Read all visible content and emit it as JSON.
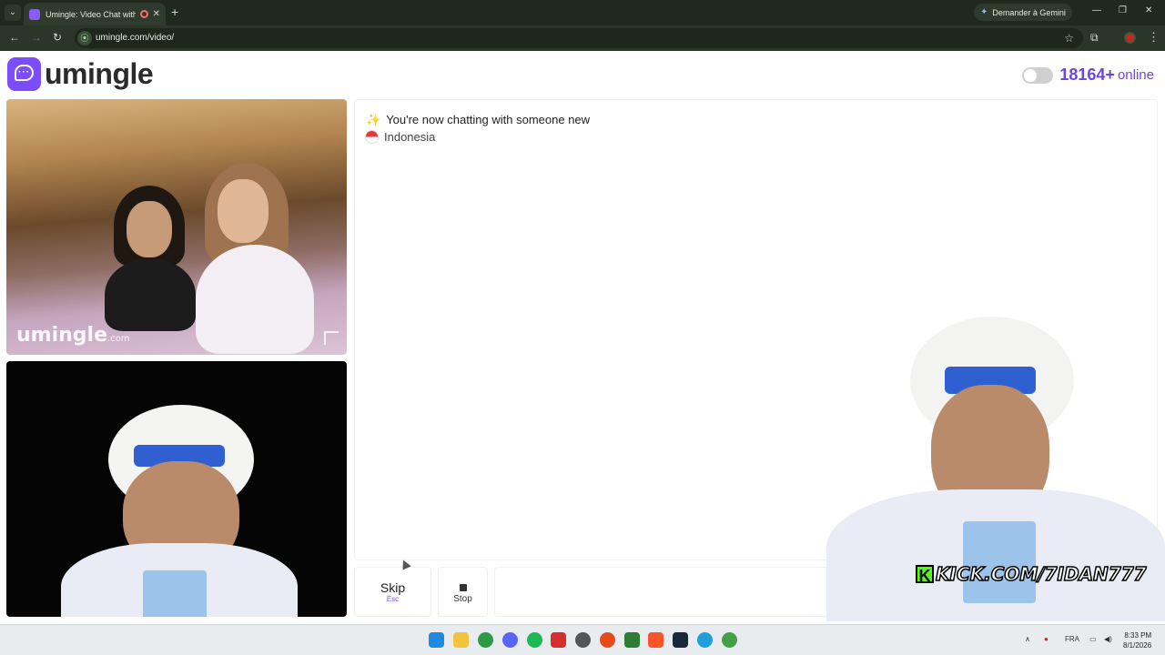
{
  "browser": {
    "tab_title": "Umingle: Video Chat with S",
    "new_tab": "+",
    "gemini_label": "Demander à Gemini",
    "url": "umingle.com/video/"
  },
  "header": {
    "logo_text": "umingle",
    "online_count": "18164+",
    "online_word": "online"
  },
  "video": {
    "watermark": "umingle",
    "watermark_suffix": ".com"
  },
  "chat": {
    "status_message": "You're now chatting with someone new",
    "country": "Indonesia"
  },
  "controls": {
    "skip_label": "Skip",
    "skip_hint": "Esc",
    "stop_label": "Stop"
  },
  "overlay": {
    "kick_text": "KICK.COM/7IDAN777"
  },
  "taskbar": {
    "language": "FRA",
    "time": "8:33 PM",
    "date": "8/1/2026"
  },
  "colors": {
    "brand": "#7c4dff",
    "online_text": "#6d44e0",
    "kick_green": "#53fc18"
  }
}
